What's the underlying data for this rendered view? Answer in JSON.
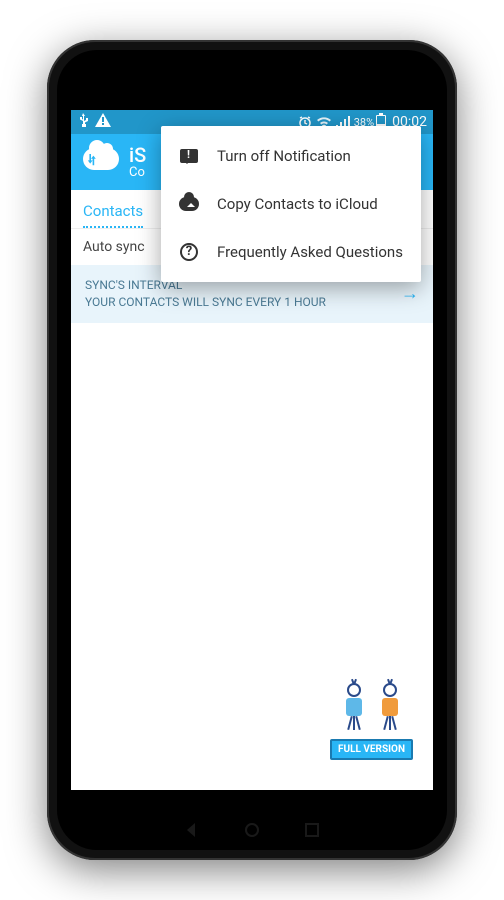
{
  "status": {
    "time": "00:02",
    "battery_pct": "38%"
  },
  "app": {
    "title": "iS",
    "subtitle": "Co"
  },
  "tabs": {
    "contacts": "Contacts"
  },
  "auto_sync_label": "Auto sync",
  "interval": {
    "line1": "SYNC'S INTERVAL",
    "line2": "YOUR CONTACTS WILL SYNC EVERY 1 HOUR"
  },
  "popup": {
    "item1": "Turn off Notification",
    "item2": "Copy Contacts to iCloud",
    "item3": "Frequently Asked Questions"
  },
  "full_version_label": "FULL VERSION"
}
